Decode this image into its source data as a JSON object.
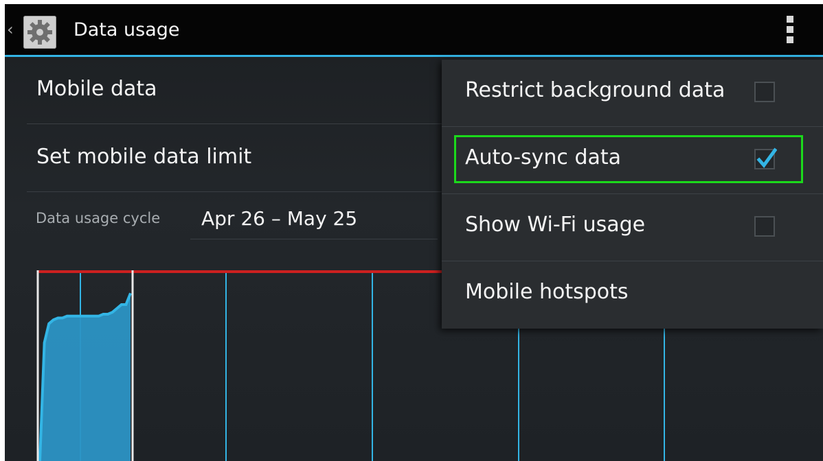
{
  "action_bar": {
    "title": "Data usage",
    "icon": "settings-gear-icon",
    "up_icon": "chevron-left-icon",
    "overflow_icon": "overflow-menu-icon"
  },
  "settings": {
    "mobile_data": "Mobile data",
    "set_limit": "Set mobile data limit",
    "cycle_label": "Data usage cycle",
    "cycle_value": "Apr 26 – May 25"
  },
  "chart_data": {
    "type": "area",
    "x": [
      0,
      1,
      2,
      3,
      4,
      5,
      6,
      7,
      8,
      9,
      10,
      11,
      12,
      13,
      14,
      15,
      16,
      17,
      18,
      19,
      20
    ],
    "values": [
      0.0,
      0.62,
      0.72,
      0.74,
      0.75,
      0.75,
      0.76,
      0.76,
      0.76,
      0.76,
      0.76,
      0.76,
      0.76,
      0.76,
      0.77,
      0.77,
      0.78,
      0.8,
      0.82,
      0.82,
      0.88
    ],
    "ylim": [
      0,
      1
    ],
    "limit_line": 1,
    "colors": {
      "fill": "#2c93c4",
      "top_line": "#33b5e5",
      "limit": "#cc2020",
      "bracket": "#e8e8e8",
      "gridline": "#33b5e5"
    }
  },
  "menu": {
    "items": [
      {
        "label": "Restrict background data",
        "checked": false
      },
      {
        "label": "Auto-sync data",
        "checked": true
      },
      {
        "label": "Show Wi-Fi usage",
        "checked": false
      },
      {
        "label": "Mobile hotspots"
      }
    ],
    "accent": "#33b5e5",
    "highlight": "#1bd91b"
  }
}
